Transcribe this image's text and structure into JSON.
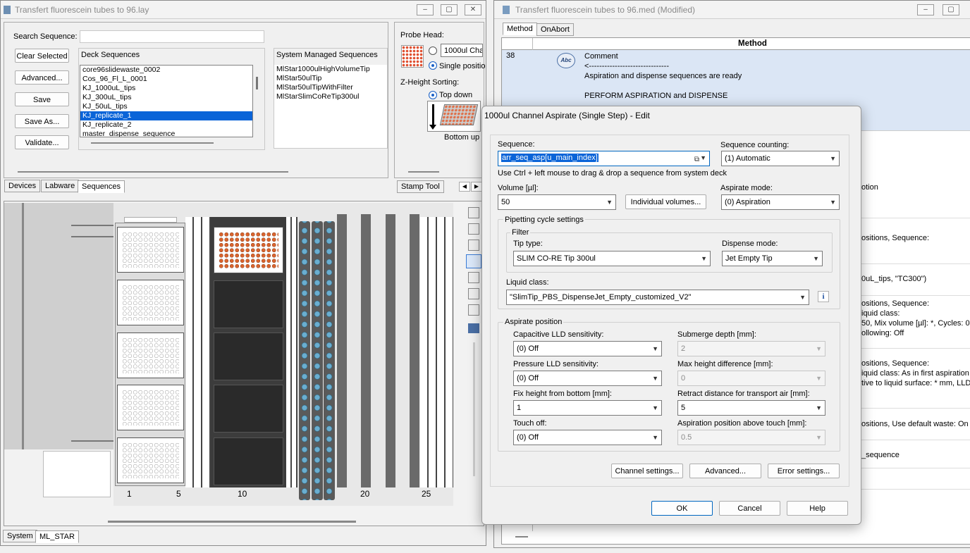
{
  "left_window": {
    "title": "Transfert fluorescein tubes to 96.lay",
    "search_label": "Search Sequence:",
    "search_value": "",
    "buttons": [
      "Clear Selected",
      "Advanced...",
      "Save",
      "Save As...",
      "Validate..."
    ],
    "deck_sequences_header": "Deck Sequences",
    "deck_sequences": [
      "core96slidewaste_0002",
      "Cos_96_Fl_L_0001",
      "KJ_1000uL_tips",
      "KJ_300uL_tips",
      "KJ_50uL_tips",
      "KJ_replicate_1",
      "KJ_replicate_2",
      "master_dispense_sequence"
    ],
    "selected_deck_sequence": "KJ_replicate_1",
    "system_sequences_header": "System Managed Sequences",
    "system_sequences": [
      "MlStar1000ulHighVolumeTip",
      "MlStar50ulTip",
      "MlStar50ulTipWithFilter",
      "MlStarSlimCoReTip300ul"
    ],
    "probe_head_label": "Probe Head:",
    "probe_head_value": "1000ul Cha",
    "single_position_label": "Single positio",
    "z_height_label": "Z-Height Sorting:",
    "top_down_label": "Top down",
    "bottom_up_label": "Bottom up",
    "tabs": [
      "Devices",
      "Labware",
      "Sequences"
    ],
    "stamp_tool_tab": "Stamp Tool",
    "deck_numbers": [
      "1",
      "5",
      "10",
      "20",
      "25"
    ],
    "bottom_tabs": [
      "System",
      "ML_STAR"
    ]
  },
  "right_window": {
    "title": "Transfert fluorescein tubes to 96.med (Modified)",
    "tabs": [
      "Method",
      "OnAbort"
    ],
    "column_header": "Method",
    "row_number": "38",
    "row_icon_text": "Abc",
    "row_lines": [
      "Comment",
      "<-------------------------------",
      "Aspiration and dispense sequences are ready",
      "",
      "PERFORM ASPIRATION and DISPENSE"
    ],
    "fragments": [
      "otion",
      "ositions, Sequence:",
      "0uL_tips, \"TC300\")",
      "ositions, Sequence:",
      "iquid class:",
      "50, Mix volume [µl]: *, Cycles: 0,",
      "ollowing: Off",
      "ositions, Sequence:",
      "iquid class: As in first aspiration",
      "tive to liquid surface: * mm, LLD",
      "ositions, Use default waste: On",
      "_sequence"
    ]
  },
  "dialog": {
    "title": "1000ul Channel Aspirate (Single Step) - Edit",
    "sequence_label": "Sequence:",
    "sequence_value": "arr_seq_asp[u_main_index]",
    "sequence_counting_label": "Sequence counting:",
    "sequence_counting_value": "(1) Automatic",
    "drag_hint": "Use Ctrl + left mouse to drag & drop a sequence from system deck",
    "volume_label": "Volume [µl]:",
    "volume_value": "50",
    "individual_volumes_button": "Individual volumes...",
    "aspirate_mode_label": "Aspirate mode:",
    "aspirate_mode_value": "(0) Aspiration",
    "pipetting_cycle_label": "Pipetting cycle settings",
    "filter_label": "Filter",
    "tip_type_label": "Tip type:",
    "tip_type_value": "SLIM CO-RE Tip 300ul",
    "dispense_mode_label": "Dispense mode:",
    "dispense_mode_value": "Jet Empty Tip",
    "liquid_class_label": "Liquid class:",
    "liquid_class_value": "\"SlimTip_PBS_DispenseJet_Empty_customized_V2\"",
    "aspirate_position_label": "Aspirate position",
    "capacitive_lld_label": "Capacitive LLD sensitivity:",
    "capacitive_lld_value": "(0) Off",
    "submerge_depth_label": "Submerge depth [mm]:",
    "submerge_depth_value": "2",
    "pressure_lld_label": "Pressure LLD sensitivity:",
    "pressure_lld_value": "(0) Off",
    "max_height_diff_label": "Max height difference [mm]:",
    "max_height_diff_value": "0",
    "fix_height_label": "Fix height from bottom [mm]:",
    "fix_height_value": "1",
    "retract_distance_label": "Retract distance for transport air [mm]:",
    "retract_distance_value": "5",
    "touch_off_label": "Touch off:",
    "touch_off_value": "(0) Off",
    "aspiration_position_label": "Aspiration position above touch [mm]:",
    "aspiration_position_value": "0.5",
    "channel_settings_button": "Channel settings...",
    "advanced_button": "Advanced...",
    "error_settings_button": "Error settings...",
    "ok_button": "OK",
    "cancel_button": "Cancel",
    "help_button": "Help"
  }
}
